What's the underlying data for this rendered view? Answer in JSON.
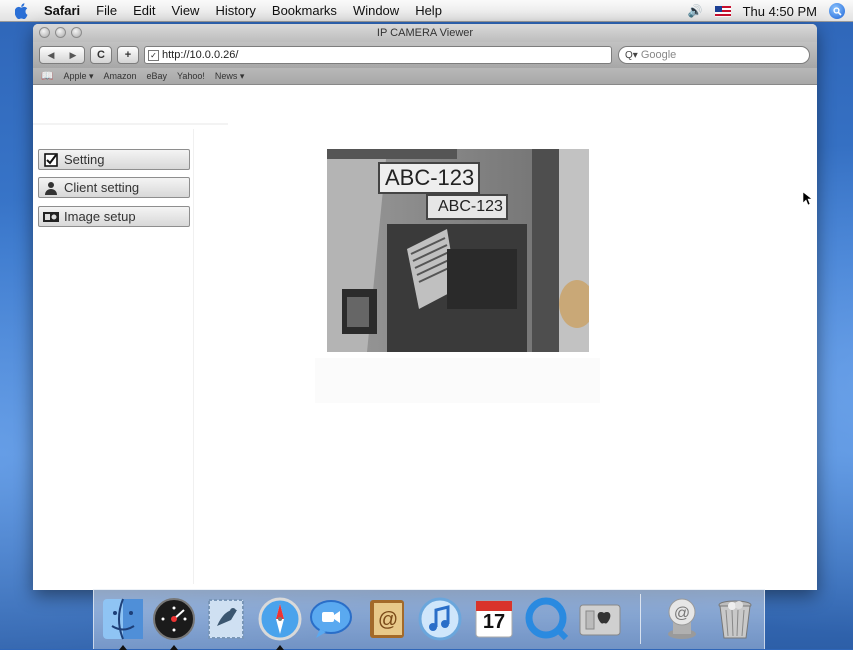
{
  "menubar": {
    "app_name": "Safari",
    "items": [
      "File",
      "Edit",
      "View",
      "History",
      "Bookmarks",
      "Window",
      "Help"
    ],
    "clock": "Thu 4:50 PM"
  },
  "window": {
    "title": "IP CAMERA Viewer"
  },
  "toolbar": {
    "reload_label": "C",
    "add_label": "+",
    "url": "http://10.0.0.26/",
    "search_placeholder": "Google"
  },
  "bookmarks": [
    "Apple ▾",
    "Amazon",
    "eBay",
    "Yahoo!",
    "News ▾"
  ],
  "sidebar": {
    "buttons": [
      {
        "label": "Setting",
        "icon": "checkbox-icon"
      },
      {
        "label": "Client setting",
        "icon": "user-icon"
      },
      {
        "label": "Image setup",
        "icon": "camera-icon"
      }
    ]
  },
  "camera_feed": {
    "plate_large": "ABC-123",
    "plate_small": "ABC-123"
  },
  "dock": {
    "items": [
      "finder-icon",
      "dashboard-icon",
      "mail-icon",
      "safari-icon",
      "ichat-icon",
      "address-book-icon",
      "itunes-icon",
      "ical-icon",
      "quicktime-icon",
      "system-preferences-icon",
      "mail-downloads-icon",
      "trash-icon"
    ],
    "ical_date": "17"
  }
}
